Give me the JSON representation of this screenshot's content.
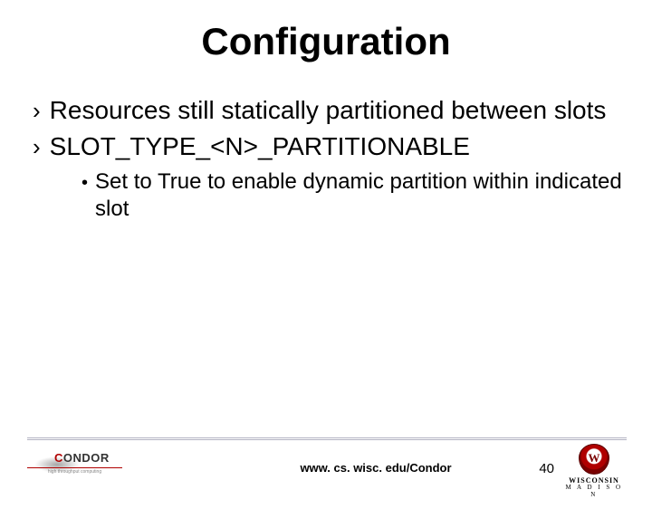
{
  "title": "Configuration",
  "bullets": [
    {
      "text": "Resources still statically partitioned between slots"
    },
    {
      "text": "SLOT_TYPE_<N>_PARTITIONABLE",
      "sub": [
        {
          "text": "Set to True to enable dynamic partition within indicated slot"
        }
      ]
    }
  ],
  "footer": {
    "url": "www. cs. wisc. edu/Condor",
    "page_number": "40",
    "left_logo": {
      "word_red": "C",
      "word_rest": "ONDOR",
      "tagline": "high throughput computing"
    },
    "right_logo": {
      "line1": "WISCONSIN",
      "line2": "M A D I S O N"
    }
  }
}
